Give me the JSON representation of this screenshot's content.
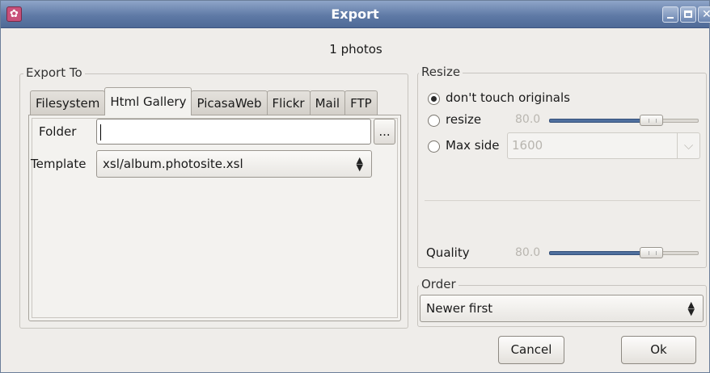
{
  "window": {
    "title": "Export",
    "app_icon": "flower-icon"
  },
  "photo_count": "1 photos",
  "export_to": {
    "legend": "Export To",
    "tabs": [
      "Filesystem",
      "Html Gallery",
      "PicasaWeb",
      "Flickr",
      "Mail",
      "FTP"
    ],
    "active_tab": "Html Gallery",
    "folder_label": "Folder",
    "folder_value": "",
    "browse_label": "...",
    "template_label": "Template",
    "template_value": "xsl/album.photosite.xsl"
  },
  "resize": {
    "legend": "Resize",
    "option_dont_touch": "don't touch originals",
    "option_resize": "resize",
    "option_max_side": "Max side",
    "selected": "don't touch originals",
    "resize_value": "80.0",
    "resize_slider_level": 0.6,
    "max_side_value": "1600",
    "quality_label": "Quality",
    "quality_value": "80.0",
    "quality_slider_level": 0.6
  },
  "order": {
    "legend": "Order",
    "value": "Newer first"
  },
  "buttons": {
    "cancel": "Cancel",
    "ok": "Ok"
  },
  "colors": {
    "titlebar": "#5f7aa6",
    "slider_fill": "#4f6f9e"
  }
}
